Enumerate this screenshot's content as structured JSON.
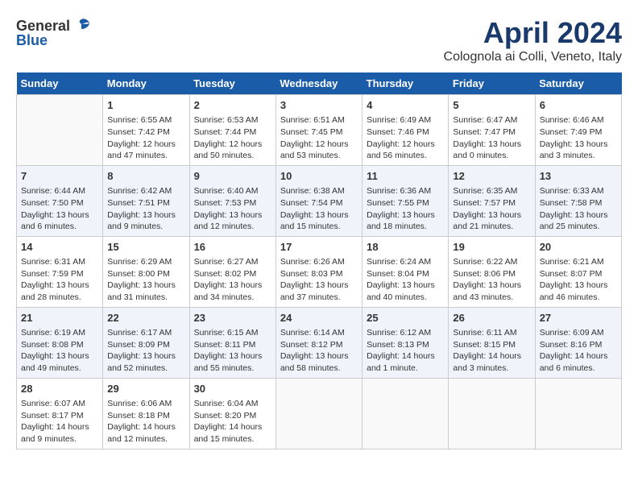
{
  "header": {
    "logo_general": "General",
    "logo_blue": "Blue",
    "title": "April 2024",
    "subtitle": "Colognola ai Colli, Veneto, Italy"
  },
  "columns": [
    "Sunday",
    "Monday",
    "Tuesday",
    "Wednesday",
    "Thursday",
    "Friday",
    "Saturday"
  ],
  "weeks": [
    [
      {
        "num": "",
        "detail": ""
      },
      {
        "num": "1",
        "detail": "Sunrise: 6:55 AM\nSunset: 7:42 PM\nDaylight: 12 hours\nand 47 minutes."
      },
      {
        "num": "2",
        "detail": "Sunrise: 6:53 AM\nSunset: 7:44 PM\nDaylight: 12 hours\nand 50 minutes."
      },
      {
        "num": "3",
        "detail": "Sunrise: 6:51 AM\nSunset: 7:45 PM\nDaylight: 12 hours\nand 53 minutes."
      },
      {
        "num": "4",
        "detail": "Sunrise: 6:49 AM\nSunset: 7:46 PM\nDaylight: 12 hours\nand 56 minutes."
      },
      {
        "num": "5",
        "detail": "Sunrise: 6:47 AM\nSunset: 7:47 PM\nDaylight: 13 hours\nand 0 minutes."
      },
      {
        "num": "6",
        "detail": "Sunrise: 6:46 AM\nSunset: 7:49 PM\nDaylight: 13 hours\nand 3 minutes."
      }
    ],
    [
      {
        "num": "7",
        "detail": "Sunrise: 6:44 AM\nSunset: 7:50 PM\nDaylight: 13 hours\nand 6 minutes."
      },
      {
        "num": "8",
        "detail": "Sunrise: 6:42 AM\nSunset: 7:51 PM\nDaylight: 13 hours\nand 9 minutes."
      },
      {
        "num": "9",
        "detail": "Sunrise: 6:40 AM\nSunset: 7:53 PM\nDaylight: 13 hours\nand 12 minutes."
      },
      {
        "num": "10",
        "detail": "Sunrise: 6:38 AM\nSunset: 7:54 PM\nDaylight: 13 hours\nand 15 minutes."
      },
      {
        "num": "11",
        "detail": "Sunrise: 6:36 AM\nSunset: 7:55 PM\nDaylight: 13 hours\nand 18 minutes."
      },
      {
        "num": "12",
        "detail": "Sunrise: 6:35 AM\nSunset: 7:57 PM\nDaylight: 13 hours\nand 21 minutes."
      },
      {
        "num": "13",
        "detail": "Sunrise: 6:33 AM\nSunset: 7:58 PM\nDaylight: 13 hours\nand 25 minutes."
      }
    ],
    [
      {
        "num": "14",
        "detail": "Sunrise: 6:31 AM\nSunset: 7:59 PM\nDaylight: 13 hours\nand 28 minutes."
      },
      {
        "num": "15",
        "detail": "Sunrise: 6:29 AM\nSunset: 8:00 PM\nDaylight: 13 hours\nand 31 minutes."
      },
      {
        "num": "16",
        "detail": "Sunrise: 6:27 AM\nSunset: 8:02 PM\nDaylight: 13 hours\nand 34 minutes."
      },
      {
        "num": "17",
        "detail": "Sunrise: 6:26 AM\nSunset: 8:03 PM\nDaylight: 13 hours\nand 37 minutes."
      },
      {
        "num": "18",
        "detail": "Sunrise: 6:24 AM\nSunset: 8:04 PM\nDaylight: 13 hours\nand 40 minutes."
      },
      {
        "num": "19",
        "detail": "Sunrise: 6:22 AM\nSunset: 8:06 PM\nDaylight: 13 hours\nand 43 minutes."
      },
      {
        "num": "20",
        "detail": "Sunrise: 6:21 AM\nSunset: 8:07 PM\nDaylight: 13 hours\nand 46 minutes."
      }
    ],
    [
      {
        "num": "21",
        "detail": "Sunrise: 6:19 AM\nSunset: 8:08 PM\nDaylight: 13 hours\nand 49 minutes."
      },
      {
        "num": "22",
        "detail": "Sunrise: 6:17 AM\nSunset: 8:09 PM\nDaylight: 13 hours\nand 52 minutes."
      },
      {
        "num": "23",
        "detail": "Sunrise: 6:15 AM\nSunset: 8:11 PM\nDaylight: 13 hours\nand 55 minutes."
      },
      {
        "num": "24",
        "detail": "Sunrise: 6:14 AM\nSunset: 8:12 PM\nDaylight: 13 hours\nand 58 minutes."
      },
      {
        "num": "25",
        "detail": "Sunrise: 6:12 AM\nSunset: 8:13 PM\nDaylight: 14 hours\nand 1 minute."
      },
      {
        "num": "26",
        "detail": "Sunrise: 6:11 AM\nSunset: 8:15 PM\nDaylight: 14 hours\nand 3 minutes."
      },
      {
        "num": "27",
        "detail": "Sunrise: 6:09 AM\nSunset: 8:16 PM\nDaylight: 14 hours\nand 6 minutes."
      }
    ],
    [
      {
        "num": "28",
        "detail": "Sunrise: 6:07 AM\nSunset: 8:17 PM\nDaylight: 14 hours\nand 9 minutes."
      },
      {
        "num": "29",
        "detail": "Sunrise: 6:06 AM\nSunset: 8:18 PM\nDaylight: 14 hours\nand 12 minutes."
      },
      {
        "num": "30",
        "detail": "Sunrise: 6:04 AM\nSunset: 8:20 PM\nDaylight: 14 hours\nand 15 minutes."
      },
      {
        "num": "",
        "detail": ""
      },
      {
        "num": "",
        "detail": ""
      },
      {
        "num": "",
        "detail": ""
      },
      {
        "num": "",
        "detail": ""
      }
    ]
  ]
}
